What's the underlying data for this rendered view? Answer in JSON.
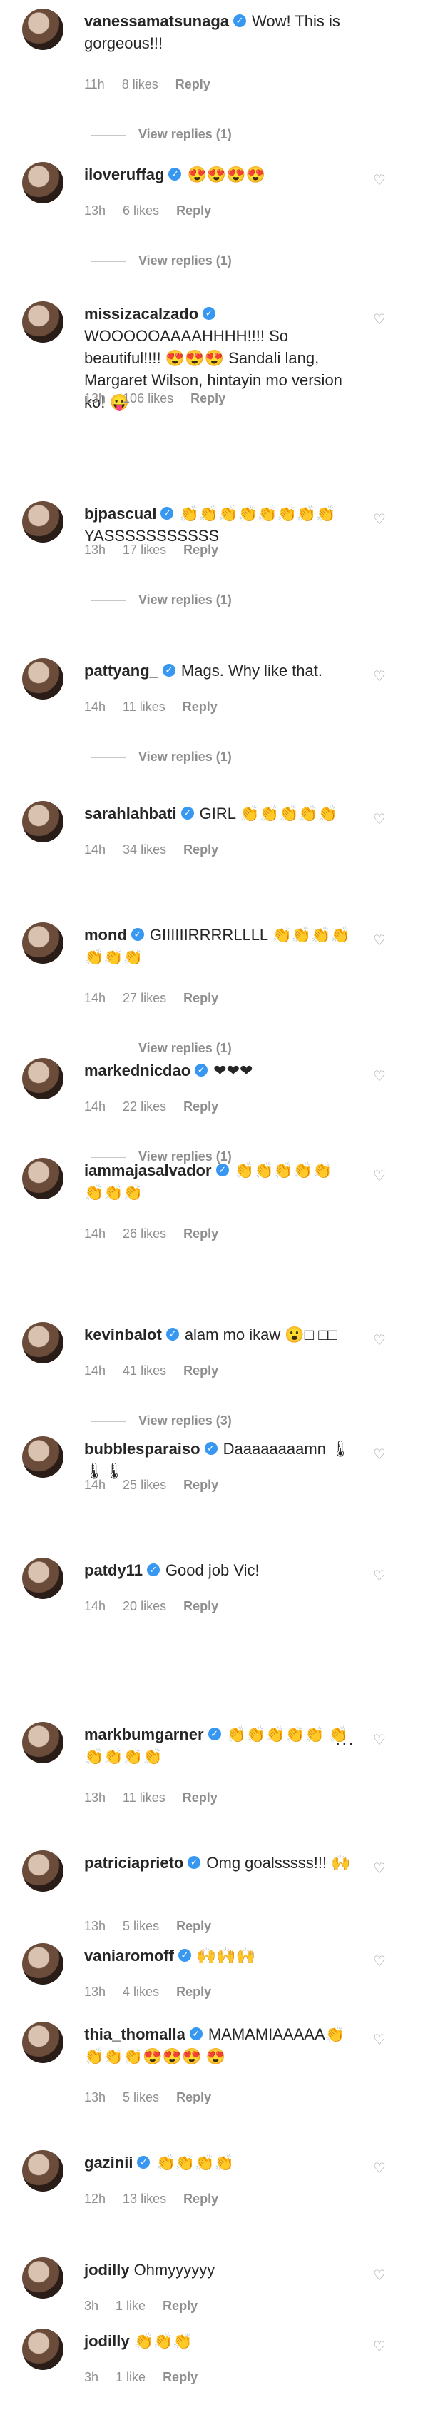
{
  "comments": [
    {
      "user": "vanessamatsunaga",
      "verified": true,
      "text": "Wow! This is gorgeous!!!",
      "time": "11h",
      "likes": "8 likes",
      "reply": "Reply",
      "view_replies": "View replies (1)"
    },
    {
      "user": "iloveruffag",
      "verified": true,
      "text": "😍😍😍😍",
      "time": "13h",
      "likes": "6 likes",
      "reply": "Reply",
      "view_replies": "View replies (1)"
    },
    {
      "user": "missizacalzado",
      "verified": true,
      "text": "WOOOOOAAAAHHHH!!!! So beautiful!!!! 😍😍😍 Sandali lang, Margaret Wilson, hintayin mo version ko! 😛",
      "time": "13h",
      "likes": "106 likes",
      "reply": "Reply",
      "view_replies": ""
    },
    {
      "user": "bjpascual",
      "verified": true,
      "text": "👏👏👏👏👏👏👏👏 YASSSSSSSSSSS",
      "time": "13h",
      "likes": "17 likes",
      "reply": "Reply",
      "view_replies": "View replies (1)"
    },
    {
      "user": "pattyang_",
      "verified": true,
      "text": "Mags. Why like that.",
      "time": "14h",
      "likes": "11 likes",
      "reply": "Reply",
      "view_replies": "View replies (1)"
    },
    {
      "user": "sarahlahbati",
      "verified": true,
      "text": "GIRL 👏👏👏👏👏",
      "time": "14h",
      "likes": "34 likes",
      "reply": "Reply",
      "view_replies": ""
    },
    {
      "user": "mond",
      "verified": true,
      "text": "GIIIIIIRRRRLLLL 👏👏👏👏 👏👏👏",
      "time": "14h",
      "likes": "27 likes",
      "reply": "Reply",
      "view_replies": "View replies (1)"
    },
    {
      "user": "markednicdao",
      "verified": true,
      "text": "❤❤❤",
      "time": "14h",
      "likes": "22 likes",
      "reply": "Reply",
      "view_replies": "View replies (1)"
    },
    {
      "user": "iammajasalvador",
      "verified": true,
      "text": "👏👏👏👏👏 👏👏👏",
      "time": "14h",
      "likes": "26 likes",
      "reply": "Reply",
      "view_replies": ""
    },
    {
      "user": "kevinbalot",
      "verified": true,
      "text": "alam mo ikaw 😮□ □□",
      "time": "14h",
      "likes": "41 likes",
      "reply": "Reply",
      "view_replies": "View replies (3)"
    },
    {
      "user": "bubblesparaiso",
      "verified": true,
      "text": "Daaaaaaaamn 🌡🌡🌡",
      "time": "14h",
      "likes": "25 likes",
      "reply": "Reply",
      "view_replies": ""
    },
    {
      "user": "patdy11",
      "verified": true,
      "text": "Good job Vic!",
      "time": "14h",
      "likes": "20 likes",
      "reply": "Reply",
      "view_replies": ""
    },
    {
      "user": "markbumgarner",
      "verified": true,
      "text": "👏👏👏👏👏 👏👏👏👏👏",
      "time": "13h",
      "likes": "11 likes",
      "reply": "Reply",
      "view_replies": ""
    },
    {
      "user": "patriciaprieto",
      "verified": true,
      "text": "Omg goalsssss!!! 🙌",
      "time": "13h",
      "likes": "5 likes",
      "reply": "Reply",
      "view_replies": ""
    },
    {
      "user": "vaniaromoff",
      "verified": true,
      "text": "🙌🙌🙌",
      "time": "13h",
      "likes": "4 likes",
      "reply": "Reply",
      "view_replies": ""
    },
    {
      "user": "thia_thomalla",
      "verified": true,
      "text": "MAMAMIAAAAA👏👏👏👏😍😍😍 😍",
      "time": "13h",
      "likes": "5 likes",
      "reply": "Reply",
      "view_replies": ""
    },
    {
      "user": "gazinii",
      "verified": true,
      "text": "👏👏👏👏",
      "time": "12h",
      "likes": "13 likes",
      "reply": "Reply",
      "view_replies": ""
    },
    {
      "user": "jodilly",
      "verified": false,
      "text": "Ohmyyyyyy",
      "time": "3h",
      "likes": "1 like",
      "reply": "Reply",
      "view_replies": ""
    },
    {
      "user": "jodilly",
      "verified": false,
      "text": "👏👏👏",
      "time": "3h",
      "likes": "1 like",
      "reply": "Reply",
      "view_replies": ""
    }
  ],
  "misc": {
    "ellipsis": "..."
  }
}
